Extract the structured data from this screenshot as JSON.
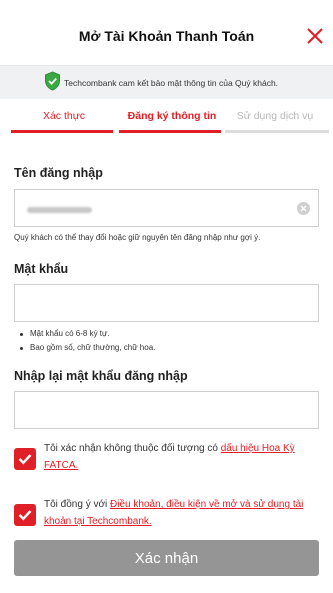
{
  "header": {
    "title": "Mở Tài Khoản Thanh Toán",
    "close_icon": "close-icon"
  },
  "notice": {
    "text": "Techcombank cam kết bảo mật thông tin của Quý khách.",
    "icon": "shield-check-icon"
  },
  "tabs": [
    {
      "label": "Xác thực",
      "state": "done"
    },
    {
      "label": "Đăng ký thông tin",
      "state": "active"
    },
    {
      "label": "Sử dụng dịch vụ",
      "state": "pending"
    }
  ],
  "username": {
    "label": "Tên đăng nhập",
    "hint": "Quý khách có thể thay đổi hoặc giữ nguyên tên đăng nhập như gợi ý."
  },
  "password": {
    "label": "Mật khẩu",
    "rules": [
      "Mật khẩu có 6-8 ký tự.",
      "Bao gồm số, chữ thường, chữ hoa."
    ]
  },
  "confirm_password": {
    "label": "Nhập lại mật khẩu đăng nhập"
  },
  "consents": [
    {
      "text": "Tôi xác nhận không thuộc đối tượng có ",
      "link": "dấu hiệu Hoa Kỳ FATCA.",
      "checked": true
    },
    {
      "text": "Tôi đồng ý với ",
      "link": "Điều khoản, điều kiện về mở và sử dụng tài khoản tại Techcombank.",
      "checked": true
    }
  ],
  "submit_label": "Xác nhận",
  "colors": {
    "accent": "#e01f26",
    "disabled_button": "#959595",
    "shield": "#3aa845"
  }
}
